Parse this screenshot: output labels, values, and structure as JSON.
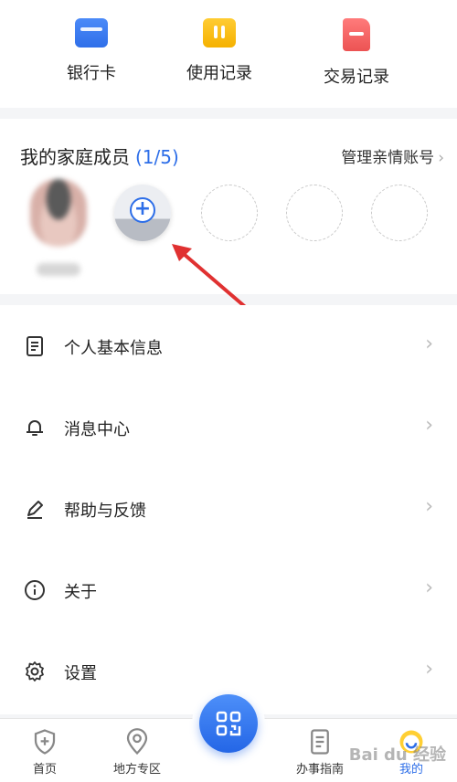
{
  "quick_actions": [
    {
      "label": "银行卡",
      "icon": "bank-card-icon"
    },
    {
      "label": "使用记录",
      "icon": "usage-record-icon"
    },
    {
      "label": "交易记录",
      "icon": "transaction-record-icon"
    }
  ],
  "family": {
    "title": "我的家庭成员",
    "count": "(1/5)",
    "manage_label": "管理亲情账号",
    "add_symbol": "+"
  },
  "menu": [
    {
      "label": "个人基本信息",
      "icon": "document-icon"
    },
    {
      "label": "消息中心",
      "icon": "bell-icon"
    },
    {
      "label": "帮助与反馈",
      "icon": "pen-icon"
    },
    {
      "label": "关于",
      "icon": "info-icon"
    },
    {
      "label": "设置",
      "icon": "gear-icon"
    }
  ],
  "nav": {
    "tabs": [
      {
        "label": "首页",
        "icon": "shield-plus-icon"
      },
      {
        "label": "地方专区",
        "icon": "location-pin-icon"
      },
      {
        "label": "办事指南",
        "icon": "guide-document-icon"
      },
      {
        "label": "我的",
        "icon": "profile-icon",
        "active": true
      }
    ],
    "center_icon": "qr-scan-icon"
  },
  "watermark": "Bai du 经验",
  "colors": {
    "accent": "#2d6ee8",
    "background": "#f4f5f7"
  }
}
